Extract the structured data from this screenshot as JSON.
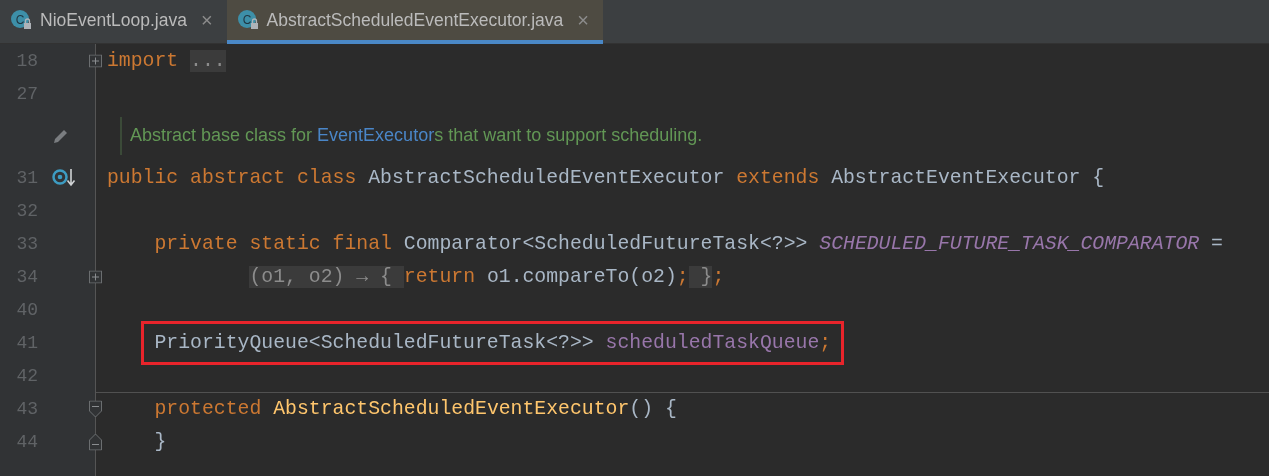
{
  "tabs": [
    {
      "label": "NioEventLoop.java",
      "icon_text": "C",
      "close": "×",
      "selected": false
    },
    {
      "label": "AbstractScheduledEventExecutor.java",
      "icon_text": "C",
      "close": "×",
      "selected": true
    }
  ],
  "editor": {
    "lines": [
      {
        "kind": "top",
        "number": "18",
        "fold": {
          "kind": "collapsed"
        },
        "tokens": [
          {
            "kind": "keyword",
            "text": "import "
          },
          {
            "kind": "folded",
            "text": "..."
          }
        ]
      },
      {
        "kind": "blank",
        "number": "27"
      },
      {
        "kind": "doc",
        "marker": {
          "kind": "edit"
        },
        "tokens": [
          {
            "kind": "doc",
            "text": "Abstract base class for "
          },
          {
            "kind": "doc-link",
            "text": "EventExecutor"
          },
          {
            "kind": "doc",
            "text": "s that want to support scheduling."
          }
        ]
      },
      {
        "kind": "top",
        "number": "31",
        "marker": {
          "kind": "implemented"
        },
        "tokens": [
          {
            "kind": "keyword",
            "text": "public abstract class "
          },
          {
            "kind": "plain",
            "text": "AbstractScheduledEventExecutor "
          },
          {
            "kind": "keyword",
            "text": "extends "
          },
          {
            "kind": "plain",
            "text": "AbstractEventExecutor {"
          }
        ]
      },
      {
        "kind": "blank",
        "number": "32"
      },
      {
        "kind": "member",
        "number": "33",
        "tokens": [
          {
            "kind": "keyword",
            "text": "private static final "
          },
          {
            "kind": "plain",
            "text": "Comparator<ScheduledFutureTask<?>> "
          },
          {
            "kind": "static-field",
            "text": "SCHEDULED_FUTURE_TASK_COMPARATOR"
          },
          {
            "kind": "plain",
            "text": " ="
          }
        ]
      },
      {
        "kind": "continuation",
        "number": "34",
        "fold": {
          "kind": "collapsed"
        },
        "tokens": [
          {
            "kind": "folded",
            "text": "(o1, o2) → { "
          },
          {
            "kind": "keyword",
            "text": "return "
          },
          {
            "kind": "plain",
            "text": "o1.compareTo(o2)"
          },
          {
            "kind": "keyword",
            "text": ";"
          },
          {
            "kind": "folded",
            "text": " }"
          },
          {
            "kind": "keyword",
            "text": ";"
          }
        ]
      },
      {
        "kind": "blank",
        "number": "40"
      },
      {
        "kind": "member",
        "number": "41",
        "highlighted": true,
        "tokens": [
          {
            "kind": "plain",
            "text": "PriorityQueue<ScheduledFutureTask<?>> "
          },
          {
            "kind": "field",
            "text": "scheduledTaskQueue"
          },
          {
            "kind": "keyword",
            "text": ";"
          }
        ]
      },
      {
        "kind": "blank",
        "number": "42"
      },
      {
        "kind": "member",
        "number": "43",
        "fold": {
          "kind": "start"
        },
        "separator": true,
        "tokens": [
          {
            "kind": "keyword",
            "text": "protected "
          },
          {
            "kind": "method-decl",
            "text": "AbstractScheduledEventExecutor"
          },
          {
            "kind": "plain",
            "text": "() {"
          }
        ]
      },
      {
        "kind": "member",
        "number": "44",
        "fold": {
          "kind": "end"
        },
        "tokens": [
          {
            "kind": "plain",
            "text": "}"
          }
        ]
      }
    ]
  }
}
